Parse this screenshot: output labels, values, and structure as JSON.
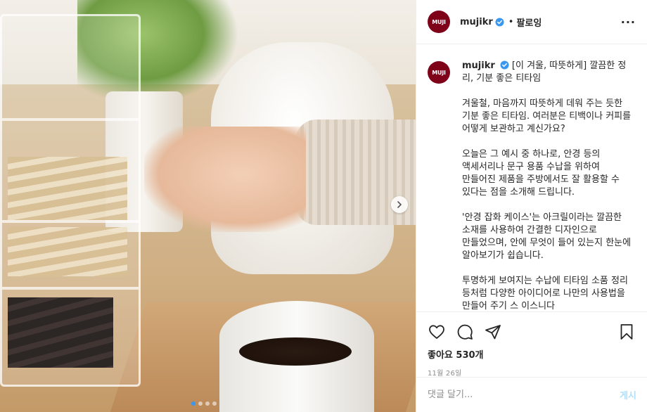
{
  "account": {
    "username": "mujikr",
    "avatar_text": "MUJI",
    "verified": true,
    "follow_label": "팔로잉",
    "separator": "•"
  },
  "caption": {
    "title": "[이 겨울, 따뜻하게] 깔끔한 정리, 기분 좋은 티타임",
    "paragraphs": [
      "겨울철, 마음까지 따뜻하게 데워 주는 듯한 기분 좋은 티타임. 여러분은 티백이나 커피를 어떻게 보관하고 계신가요?",
      "오늘은 그 예시 중 하나로, 안경 등의 액세서리나 문구 용품 수납을 위하여 만들어진 제품을 주방에서도 잘 활용할 수 있다는 점을 소개해 드립니다.",
      "'안경 잡화 케이스'는 아크릴이라는 깔끔한 소재를 사용하여 간결한 디자인으로 만들었으며, 안에 무엇이 들어 있는지 한눈에 알아보기가 쉽습니다.",
      "투명하게 보여지는 수납에 티타임 소품 정리 등처럼 다양한 아이디어로 나만의 사용법을 만들어 주기 스 이스니다"
    ]
  },
  "engagement": {
    "likes_text": "좋아요 530개",
    "date_text": "11월 26일"
  },
  "comment": {
    "placeholder": "댓글 달기...",
    "post_label": "게시"
  },
  "carousel": {
    "total": 4,
    "active_index": 0
  },
  "icons": {
    "more": "more-options-icon",
    "like": "heart-icon",
    "comment": "comment-icon",
    "share": "share-icon",
    "save": "bookmark-icon",
    "next": "chevron-right-icon",
    "verified": "verified-badge-icon"
  },
  "colors": {
    "brand": "#7f0019",
    "verified": "#3897f0",
    "post_button": "#b2dffc",
    "muted": "#8e8e8e"
  }
}
